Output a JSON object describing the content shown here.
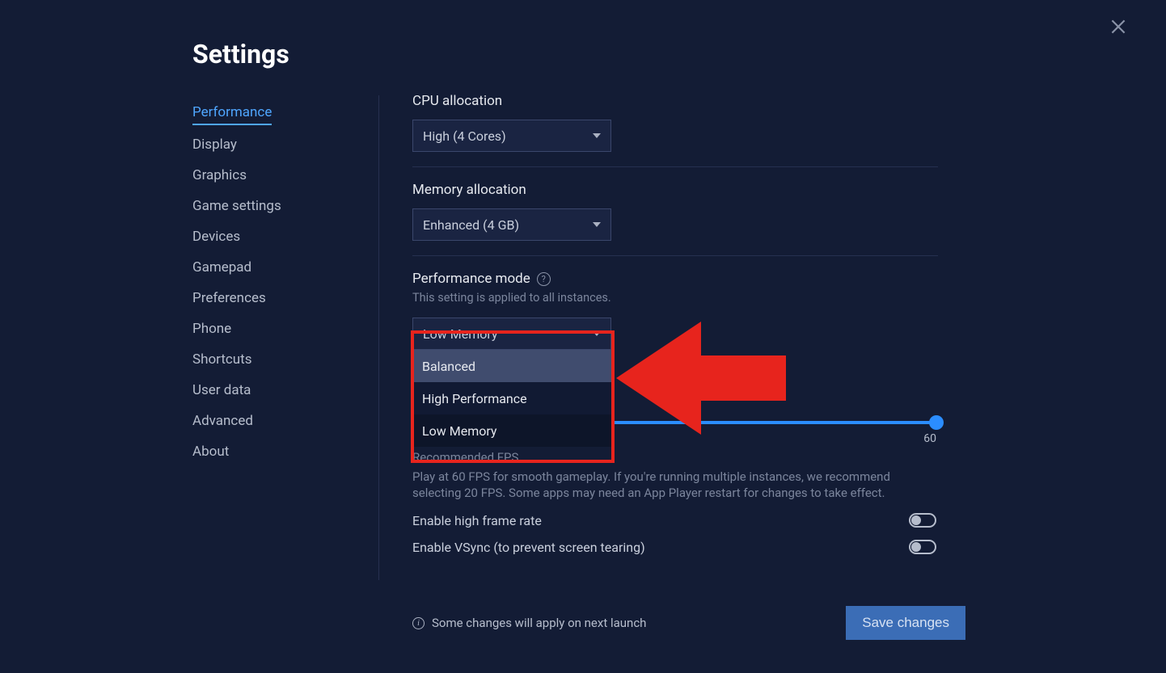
{
  "title": "Settings",
  "sidebar": {
    "items": [
      {
        "label": "Performance",
        "active": true
      },
      {
        "label": "Display"
      },
      {
        "label": "Graphics"
      },
      {
        "label": "Game settings"
      },
      {
        "label": "Devices"
      },
      {
        "label": "Gamepad"
      },
      {
        "label": "Preferences"
      },
      {
        "label": "Phone"
      },
      {
        "label": "Shortcuts"
      },
      {
        "label": "User data"
      },
      {
        "label": "Advanced"
      },
      {
        "label": "About"
      }
    ]
  },
  "cpu": {
    "label": "CPU allocation",
    "value": "High (4 Cores)"
  },
  "memory": {
    "label": "Memory allocation",
    "value": "Enhanced (4 GB)"
  },
  "perf_mode": {
    "label": "Performance mode",
    "sub": "This setting is applied to all instances.",
    "value": "Low Memory",
    "options": [
      "Balanced",
      "High Performance",
      "Low Memory"
    ]
  },
  "fps": {
    "max_label": "60",
    "rec_heading": "Recommended FPS",
    "rec_body": "Play at 60 FPS for smooth gameplay. If you're running multiple instances, we recommend selecting 20 FPS. Some apps may need an App Player restart for changes to take effect."
  },
  "toggles": {
    "high_frame": "Enable high frame rate",
    "vsync": "Enable VSync (to prevent screen tearing)"
  },
  "footer": {
    "info": "Some changes will apply on next launch",
    "save": "Save changes"
  }
}
